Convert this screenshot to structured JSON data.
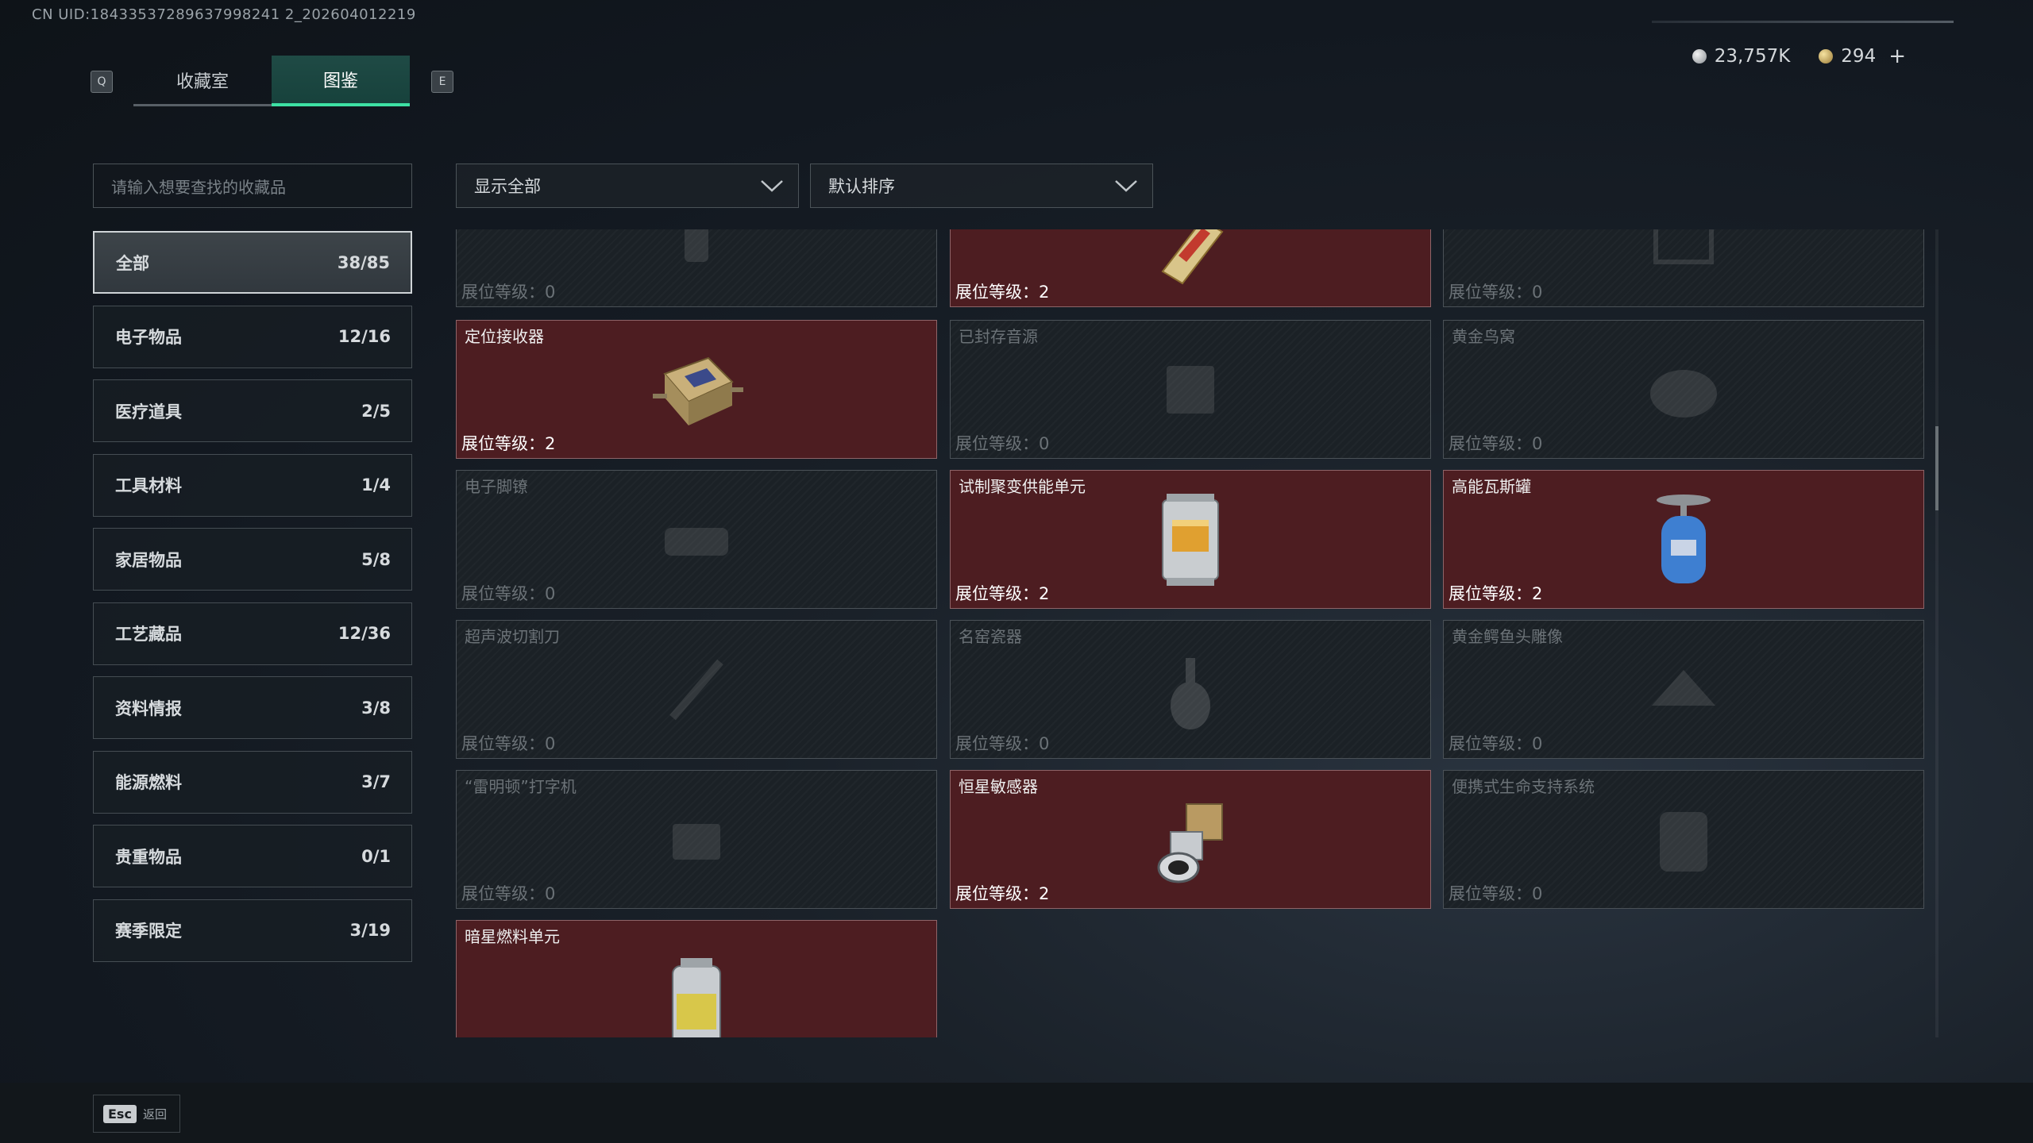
{
  "uid": "CN UID:18433537289637998241 2_202604012219",
  "currency": {
    "silver": "23,757K",
    "gold": "294",
    "plus": "+"
  },
  "keys": {
    "left": "Q",
    "right": "E",
    "esc": "Esc"
  },
  "tabs": [
    {
      "label": "收藏室"
    },
    {
      "label": "图鉴"
    }
  ],
  "search": {
    "placeholder": "请输入想要查找的收藏品"
  },
  "filter": {
    "value": "显示全部"
  },
  "sort": {
    "value": "默认排序"
  },
  "categories": [
    {
      "label": "全部",
      "count": "38/85"
    },
    {
      "label": "电子物品",
      "count": "12/16"
    },
    {
      "label": "医疗道具",
      "count": "2/5"
    },
    {
      "label": "工具材料",
      "count": "1/4"
    },
    {
      "label": "家居物品",
      "count": "5/8"
    },
    {
      "label": "工艺藏品",
      "count": "12/36"
    },
    {
      "label": "资料情报",
      "count": "3/8"
    },
    {
      "label": "能源燃料",
      "count": "3/7"
    },
    {
      "label": "贵重物品",
      "count": "0/1"
    },
    {
      "label": "赛季限定",
      "count": "3/19"
    }
  ],
  "items": [
    {
      "name": "",
      "level": "展位等级：0",
      "owned": false
    },
    {
      "name": "",
      "level": "展位等级：2",
      "owned": true
    },
    {
      "name": "",
      "level": "展位等级：0",
      "owned": false
    },
    {
      "name": "定位接收器",
      "level": "展位等级：2",
      "owned": true
    },
    {
      "name": "已封存音源",
      "level": "展位等级：0",
      "owned": false
    },
    {
      "name": "黄金鸟窝",
      "level": "展位等级：0",
      "owned": false
    },
    {
      "name": "电子脚镣",
      "level": "展位等级：0",
      "owned": false
    },
    {
      "name": "试制聚变供能单元",
      "level": "展位等级：2",
      "owned": true
    },
    {
      "name": "高能瓦斯罐",
      "level": "展位等级：2",
      "owned": true
    },
    {
      "name": "超声波切割刀",
      "level": "展位等级：0",
      "owned": false
    },
    {
      "name": "名窑瓷器",
      "level": "展位等级：0",
      "owned": false
    },
    {
      "name": "黄金鳄鱼头雕像",
      "level": "展位等级：0",
      "owned": false
    },
    {
      "name": "“雷明顿”打字机",
      "level": "展位等级：0",
      "owned": false
    },
    {
      "name": "恒星敏感器",
      "level": "展位等级：2",
      "owned": true
    },
    {
      "name": "便携式生命支持系统",
      "level": "展位等级：0",
      "owned": false
    },
    {
      "name": "暗星燃料单元",
      "level": "",
      "owned": true
    }
  ],
  "footer": {
    "back_label": "返回"
  }
}
